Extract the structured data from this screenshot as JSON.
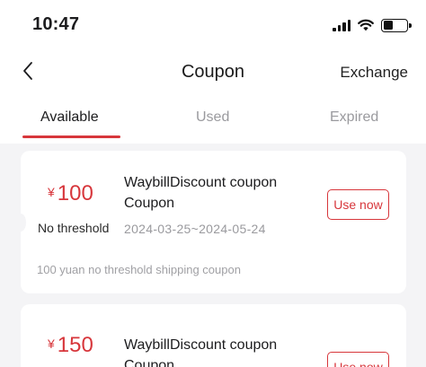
{
  "status_bar": {
    "time": "10:47"
  },
  "nav": {
    "title": "Coupon",
    "right_action": "Exchange"
  },
  "tabs": [
    {
      "label": "Available",
      "active": true
    },
    {
      "label": "Used",
      "active": false
    },
    {
      "label": "Expired",
      "active": false
    }
  ],
  "coupons": [
    {
      "currency": "¥",
      "amount": "100",
      "threshold": "No threshold",
      "title": "WaybillDiscount coupon Coupon",
      "validity": "2024-03-25~2024-05-24",
      "action": "Use now",
      "description": "100 yuan no threshold shipping coupon"
    },
    {
      "currency": "¥",
      "amount": "150",
      "title": "WaybillDiscount coupon Coupon",
      "action": "Use now"
    }
  ],
  "colors": {
    "accent": "#d7363b",
    "background": "#f4f4f6",
    "card": "#ffffff",
    "muted_text": "#9a9a9e"
  },
  "icons": {
    "back": "chevron-left-icon",
    "signal": "cellular-signal-icon",
    "wifi": "wifi-icon",
    "battery": "battery-icon"
  }
}
